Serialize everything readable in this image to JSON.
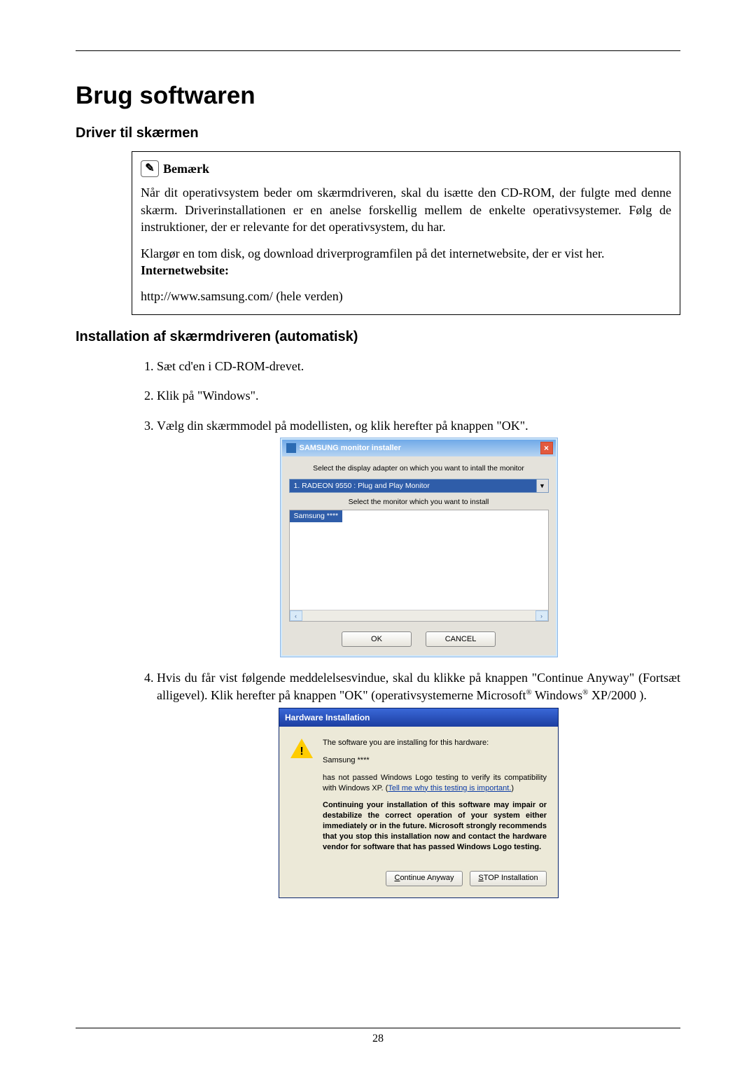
{
  "page": {
    "title": "Brug softwaren",
    "footer_page": "28"
  },
  "section1": {
    "heading": "Driver til skærmen"
  },
  "note": {
    "label": "Bemærk",
    "para1": "Når dit operativsystem beder om skærmdriveren, skal du isætte den CD-ROM, der fulgte med denne skærm. Driverinstallationen er en anelse forskellig mellem de enkelte operativsystemer. Følg de instruktioner, der er relevante for det operativsystem, du har.",
    "para2": "Klargør en tom disk, og download driverprogramfilen på det internetwebsite, der er vist her.",
    "int_label": "Internetwebsite:",
    "url": "http://www.samsung.com/ (hele verden)"
  },
  "section2": {
    "heading": "Installation af skærmdriveren (automatisk)",
    "items": [
      "Sæt cd'en i CD-ROM-drevet.",
      "Klik på \"Windows\".",
      "Vælg din skærmmodel på modellisten, og klik herefter på knappen \"OK\".",
      "Hvis du får vist følgende meddelelsesvindue, skal du klikke på knappen \"Continue Anyway\" (Fortsæt alligevel). Klik herefter på knappen \"OK\" (operativsystemerne Microsoft® Windows® XP/2000 )."
    ]
  },
  "installer": {
    "title": "SAMSUNG monitor installer",
    "line1": "Select the display adapter on which you want to intall the monitor",
    "adapter": "1. RADEON 9550 : Plug and Play Monitor",
    "line2": "Select the monitor which you want to install",
    "list_item": "Samsung ****",
    "btn_ok": "OK",
    "btn_cancel": "CANCEL"
  },
  "hw": {
    "title": "Hardware Installation",
    "p1": "The software you are installing for this hardware:",
    "p2": "Samsung ****",
    "p3a": "has not passed Windows Logo testing to verify its compatibility with Windows XP. (",
    "p3_link": "Tell me why this testing is important.",
    "p3b": ")",
    "p4": "Continuing your installation of this software may impair or destabilize the correct operation of your system either immediately or in the future. Microsoft strongly recommends that you stop this installation now and contact the hardware vendor for software that has passed Windows Logo testing.",
    "btn_continue": "Continue Anyway",
    "btn_stop": "STOP Installation"
  }
}
